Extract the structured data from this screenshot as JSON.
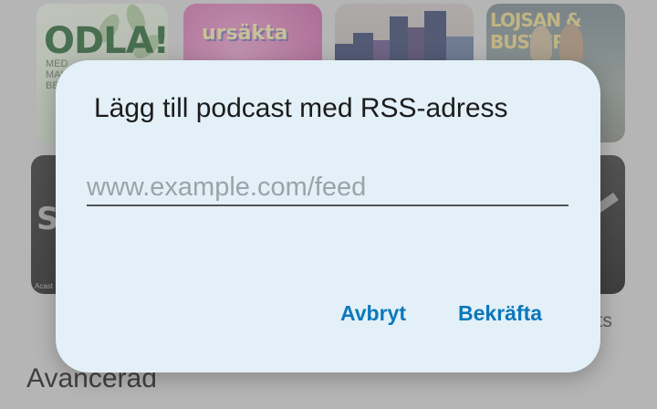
{
  "background": {
    "tiles": {
      "odla": {
        "title": "ODLA!",
        "subtitle": "MED MALL & BE…"
      },
      "ursakta": {
        "title": "ursäkta"
      },
      "lojsan": {
        "title": "LOJSAN & BUSTER"
      },
      "sv": {
        "title": "SV",
        "footer": "Acast"
      }
    },
    "section_heading": "Avancerad",
    "right_label_fragment": "sts"
  },
  "dialog": {
    "title": "Lägg till podcast med RSS-adress",
    "input_placeholder": "www.example.com/feed",
    "input_value": "",
    "cancel_label": "Avbryt",
    "confirm_label": "Bekräfta"
  },
  "colors": {
    "dialog_bg": "#e3f0f8",
    "accent": "#0b78ba"
  }
}
